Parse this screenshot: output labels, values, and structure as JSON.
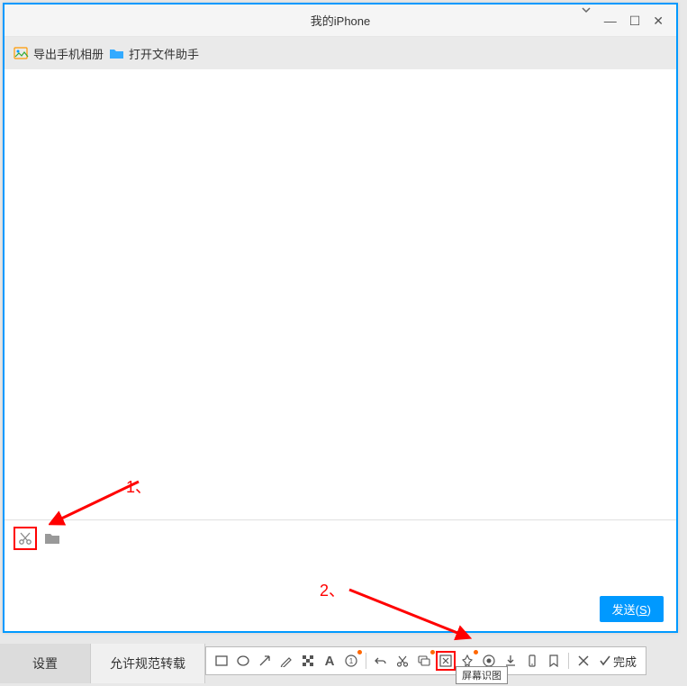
{
  "window": {
    "title": "我的iPhone",
    "controls": {
      "dropdown": "⌄",
      "min": "—",
      "max": "☐",
      "close": "✕"
    }
  },
  "toolbar": {
    "export_label": "导出手机相册",
    "openfile_label": "打开文件助手"
  },
  "input": {
    "send_label": "发送",
    "send_key": "S"
  },
  "annotations": {
    "one": "1、",
    "two": "2、"
  },
  "bottom": {
    "settings": "设置",
    "allow": "允许规范转载"
  },
  "snip": {
    "done": "完成",
    "tooltip": "屏幕识图"
  }
}
